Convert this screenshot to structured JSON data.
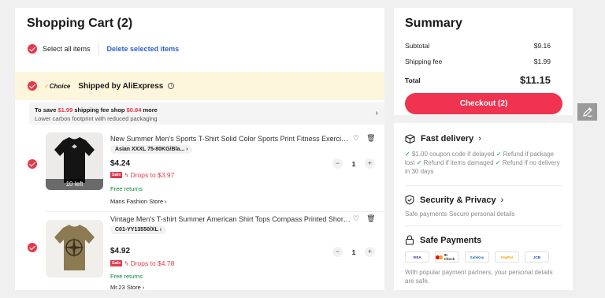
{
  "cart": {
    "title": "Shopping Cart (2)",
    "select_all_label": "Select all items",
    "delete_selected_label": "Delete selected items",
    "store_group": {
      "badge": "Choice",
      "title": "Shipped by AliExpress",
      "promo_prefix": "To save",
      "promo_save": "$1.99",
      "promo_mid": "shipping fee shop",
      "promo_amount": "$0.84",
      "promo_suffix": "more",
      "promo_sub": "Lower carbon footprint with reduced packaging"
    },
    "items": [
      {
        "title": "New Summer Men's Sports T-Shirt Solid Color Sports Print Fitness Exercise J...",
        "sku": "Asian XXXL 75-80KG/Bla...",
        "price": "$4.24",
        "sale_badge": "Sale",
        "drops_to": "Drops to $3.97",
        "returns": "Free returns",
        "store": "Mans Fashion Store",
        "quantity": "1",
        "stock_badge": "10 left"
      },
      {
        "title": "Vintage Men's T-shirt Summer American Shirt Tops Compass Printed Short-s...",
        "sku": "C01-YY13550/XL",
        "price": "$4.92",
        "sale_badge": "Sale",
        "drops_to": "Drops to $4.78",
        "returns": "Free returns",
        "store": "Mr.23 Store",
        "quantity": "1"
      }
    ]
  },
  "summary": {
    "title": "Summary",
    "subtotal_label": "Subtotal",
    "subtotal_value": "$9.16",
    "shipping_label": "Shipping fee",
    "shipping_value": "$1.99",
    "total_label": "Total",
    "total_value": "$11.15",
    "checkout_label": "Checkout (2)"
  },
  "info": {
    "fast_delivery": {
      "title": "Fast delivery",
      "line1": "$1.00 coupon code if delayed",
      "line2": "Refund if package lost",
      "line3": "Refund if items damaged",
      "line4": "Refund if no delivery in 30 days"
    },
    "security": {
      "title": "Security & Privacy",
      "text": "Safe payments·Secure personal details"
    },
    "payments": {
      "title": "Safe Payments",
      "methods": [
        "VISA",
        "ID Check",
        "SafeKey",
        "PayPal",
        "JCB"
      ],
      "text": "With popular payment partners, your personal details are safe."
    }
  },
  "colors": {
    "accent": "#e4394a",
    "checkout": "#f0334f",
    "link": "#2e5ec8",
    "choice_bg": "#fdf6dc",
    "green": "#0a8a3c"
  },
  "icons": {
    "checkbox": "check-circle-icon",
    "info": "info-icon",
    "heart": "heart-icon",
    "trash": "trash-icon",
    "truck": "truck-icon",
    "shield": "shield-icon",
    "lock": "lock-icon",
    "edit": "edit-pencil-icon"
  }
}
